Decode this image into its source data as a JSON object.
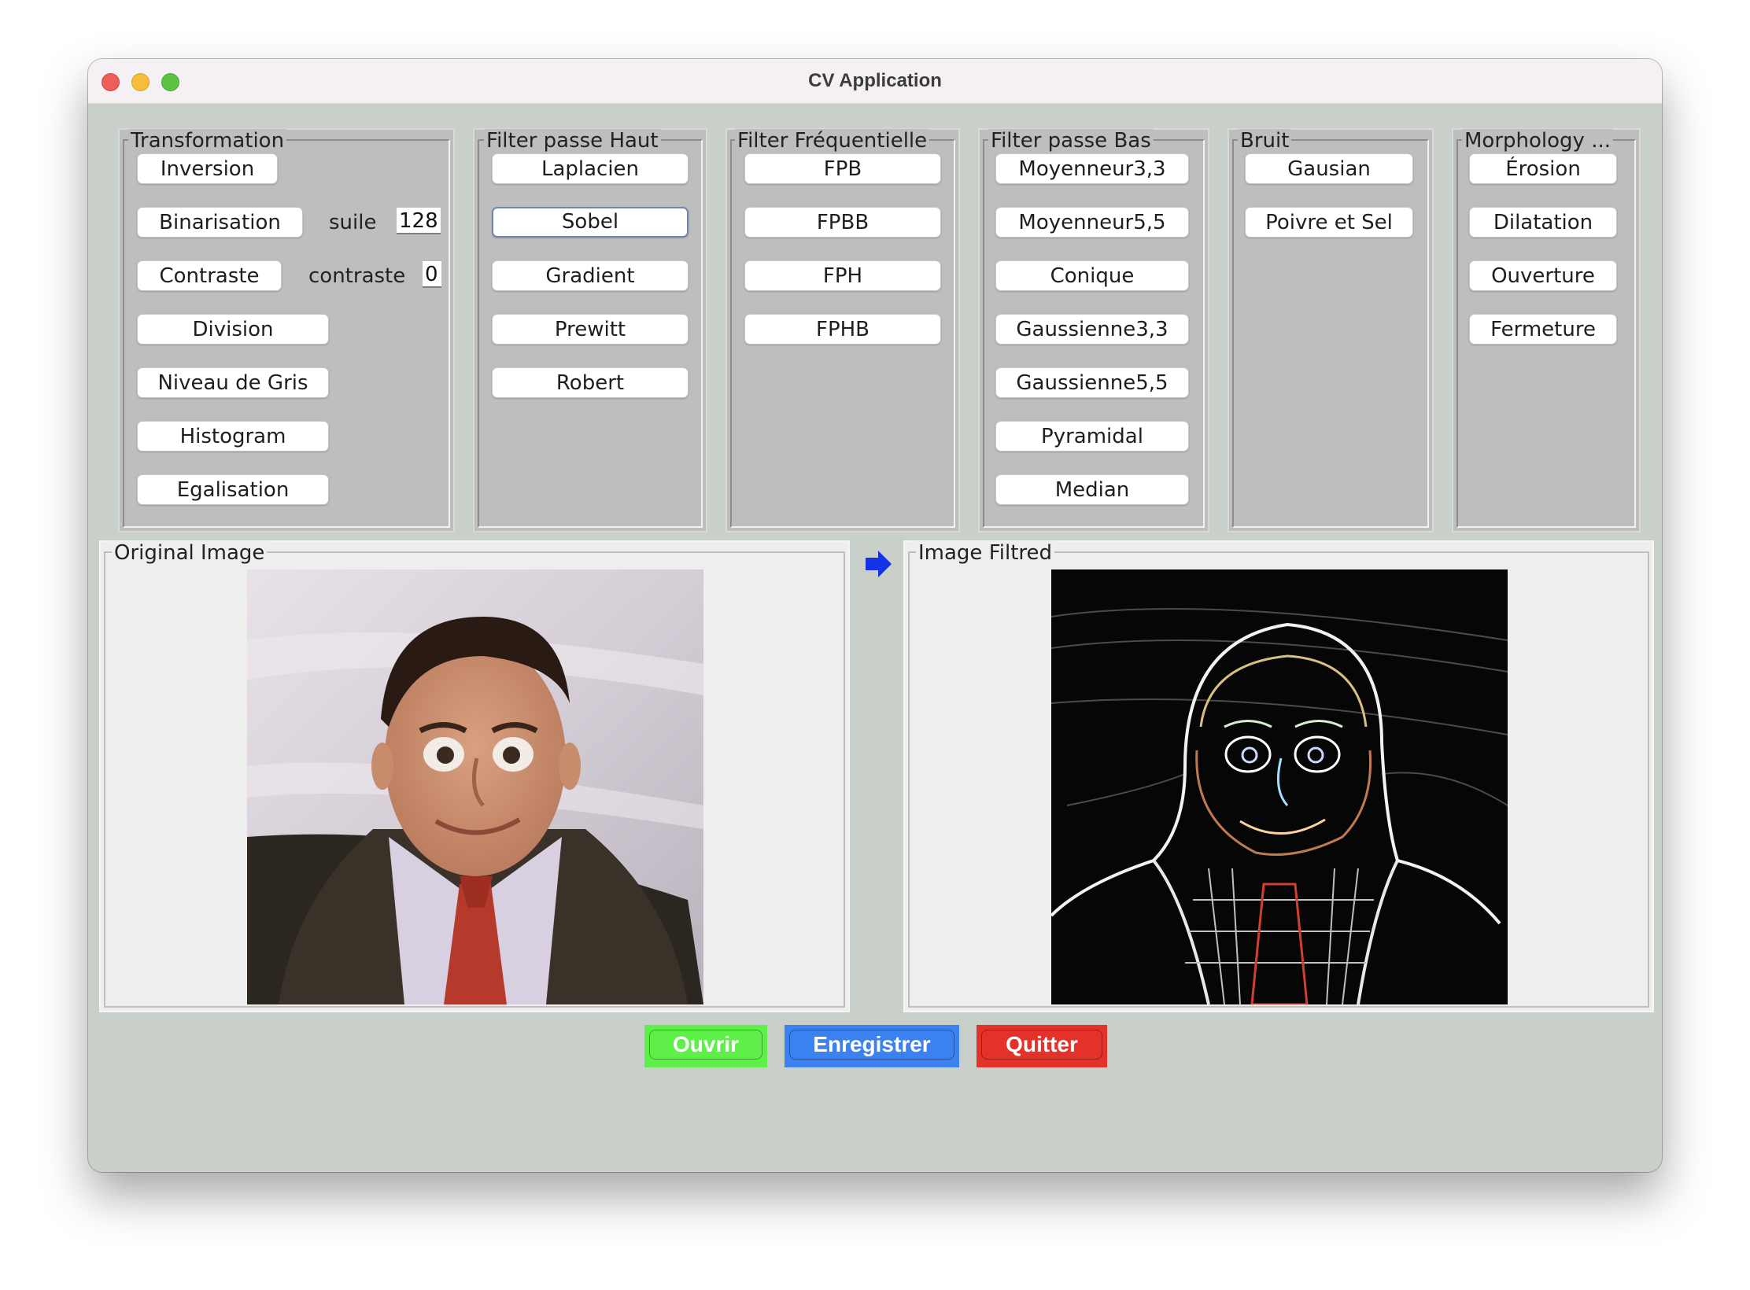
{
  "window": {
    "title": "CV Application"
  },
  "groups": {
    "transformation": {
      "title": "Transformation",
      "buttons": [
        "Inversion",
        "Binarisation",
        "Contraste",
        "Division",
        "Niveau de Gris",
        "Histogram",
        "Egalisation"
      ],
      "threshold_label": "suile",
      "threshold_value": "128",
      "contrast_label": "contraste",
      "contrast_value": "0"
    },
    "high_pass": {
      "title": "Filter passe Haut",
      "buttons": [
        "Laplacien",
        "Sobel",
        "Gradient",
        "Prewitt",
        "Robert"
      ],
      "focused": "Sobel"
    },
    "frequency": {
      "title": "Filter Fréquentielle",
      "buttons": [
        "FPB",
        "FPBB",
        "FPH",
        "FPHB"
      ]
    },
    "low_pass": {
      "title": "Filter passe Bas",
      "buttons": [
        "Moyenneur3,3",
        "Moyenneur5,5",
        "Conique",
        "Gaussienne3,3",
        "Gaussienne5,5",
        "Pyramidal",
        "Median"
      ]
    },
    "noise": {
      "title": "Bruit",
      "buttons": [
        "Gausian",
        "Poivre et Sel"
      ]
    },
    "morphology": {
      "title": "Morphology ...",
      "buttons": [
        "Érosion",
        "Dilatation",
        "Ouverture",
        "Fermeture"
      ]
    }
  },
  "panels": {
    "original": {
      "title": "Original Image"
    },
    "filtered": {
      "title": "Image Filtred"
    }
  },
  "actions": {
    "open": "Ouvrir",
    "save": "Enregistrer",
    "quit": "Quitter"
  },
  "colors": {
    "open": "#5ef049",
    "save": "#3b82f0",
    "quit": "#e4312a",
    "arrow": "#1432e8"
  }
}
